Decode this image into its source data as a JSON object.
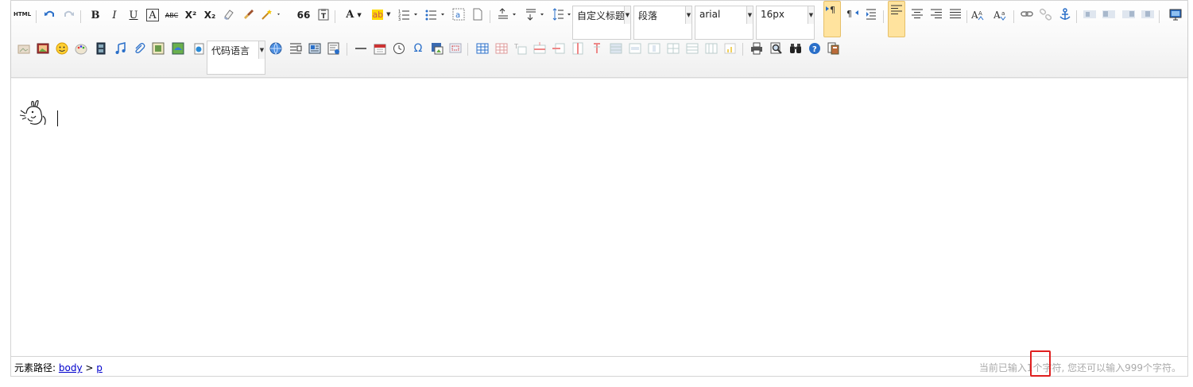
{
  "toolbar": {
    "row1_buttons": [
      {
        "name": "html-source-button",
        "label": "HTML"
      },
      {
        "name": "undo-button",
        "icon": "undo-icon"
      },
      {
        "name": "redo-button",
        "icon": "redo-icon"
      },
      {
        "name": "bold-button",
        "label": "B"
      },
      {
        "name": "italic-button",
        "label": "I"
      },
      {
        "name": "underline-button",
        "label": "U"
      },
      {
        "name": "font-border-button",
        "label": "A"
      },
      {
        "name": "strikethrough-button",
        "label": "ABC"
      },
      {
        "name": "superscript-button",
        "label": "X²"
      },
      {
        "name": "subscript-button",
        "label": "X₂"
      },
      {
        "name": "remove-format-button",
        "icon": "eraser-icon"
      },
      {
        "name": "format-match-button",
        "icon": "brush-icon"
      },
      {
        "name": "auto-typeset-button",
        "icon": "magic-wand-icon"
      },
      {
        "name": "blockquote-button",
        "label": "66"
      },
      {
        "name": "paste-plain-button",
        "label": "T"
      },
      {
        "name": "forecolor-button",
        "label": "A"
      },
      {
        "name": "backcolor-button",
        "label": "ab"
      },
      {
        "name": "ordered-list-button",
        "icon": "ordered-list-icon"
      },
      {
        "name": "unordered-list-button",
        "icon": "unordered-list-icon"
      },
      {
        "name": "select-all-button",
        "label": "a"
      },
      {
        "name": "clear-doc-button",
        "icon": "blank-page-icon"
      },
      {
        "name": "row-spacing-top-button",
        "icon": "spacing-top-icon"
      },
      {
        "name": "row-spacing-bottom-button",
        "icon": "spacing-bottom-icon"
      },
      {
        "name": "line-height-button",
        "icon": "line-height-icon"
      }
    ],
    "combos": {
      "custom_style": "自定义标题",
      "paragraph": "段落",
      "font_family": "arial",
      "font_size": "16px",
      "code_language": "代码语言",
      "arrow": "▼"
    }
  },
  "editor": {
    "content_emoticon": "bunny-emoticon-icon"
  },
  "statusbar": {
    "path_label": "元素路径:",
    "path_body": "body",
    "path_sep": " > ",
    "path_p": "p",
    "wordcount": "当前已输入1个字符, 您还可以输入999个字符。"
  },
  "colors": {
    "accent_active": "#ffe39e",
    "link": "#0000cc",
    "highlight": "#e02020",
    "status_text": "#aaaaaa"
  }
}
